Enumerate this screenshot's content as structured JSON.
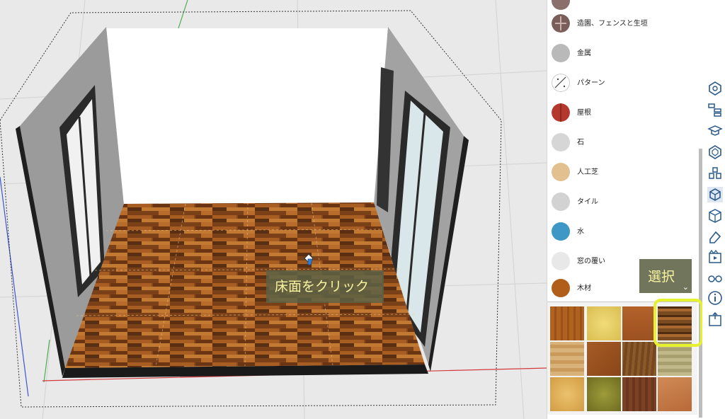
{
  "viewport": {
    "tooltip_text": "床面をクリック",
    "cursor_icon": "paint-bucket-icon"
  },
  "material_panel": {
    "categories": [
      {
        "label": "",
        "icon": "material-swatch",
        "color": "#8a6f6a"
      },
      {
        "label": "造園、フェンスと生垣",
        "icon": "fence-swatch",
        "color": "#7a5e5a"
      },
      {
        "label": "金属",
        "icon": "metal-swatch",
        "color": "#b9b9b9"
      },
      {
        "label": "パターン",
        "icon": "pattern-swatch",
        "color": "#ffffff"
      },
      {
        "label": "屋根",
        "icon": "roof-swatch",
        "color": "#b4382d"
      },
      {
        "label": "石",
        "icon": "stone-swatch",
        "color": "#d6d6d6"
      },
      {
        "label": "人工芝",
        "icon": "turf-swatch",
        "color": "#e2c08f"
      },
      {
        "label": "タイル",
        "icon": "tile-swatch",
        "color": "#d2d2d2"
      },
      {
        "label": "水",
        "icon": "water-swatch",
        "color": "#3f97c5"
      },
      {
        "label": "窓の覆い",
        "icon": "window-covering-swatch",
        "color": "#e8e8e8"
      },
      {
        "label": "木材",
        "icon": "wood-swatch",
        "color": "#b25e1b"
      }
    ],
    "select_label": "選択",
    "select_chevron": "⌄",
    "thumbnails": [
      {
        "name": "wood-thumb-1",
        "color": "#b0621f"
      },
      {
        "name": "wood-thumb-2",
        "color": "#e8d06a"
      },
      {
        "name": "wood-thumb-3",
        "color": "#a85a26"
      },
      {
        "name": "wood-thumb-4",
        "color": "#7a4a20"
      },
      {
        "name": "wood-thumb-5",
        "color": "#d9b27a"
      },
      {
        "name": "wood-thumb-6",
        "color": "#9a5424"
      },
      {
        "name": "wood-thumb-7",
        "color": "#8b5a2b"
      },
      {
        "name": "wood-thumb-8",
        "color": "#c2b98a"
      },
      {
        "name": "wood-thumb-9",
        "color": "#e0b25e"
      },
      {
        "name": "wood-thumb-10",
        "color": "#8a8a2e"
      },
      {
        "name": "wood-thumb-11",
        "color": "#7d4225"
      },
      {
        "name": "wood-thumb-12",
        "color": "#c47a48"
      }
    ]
  },
  "toolbar": {
    "tools": [
      "entity-info-icon",
      "outliner-icon",
      "instructor-icon",
      "components-icon",
      "styles-icon",
      "materials-icon",
      "tags-icon",
      "scenes-icon",
      "shadows-icon",
      "soften-edges-icon",
      "display-icon",
      "info-icon",
      "export-icon"
    ]
  },
  "colors": {
    "accent_yellow": "#e5f22d",
    "tooltip_bg": "#5c6246",
    "tooltip_text": "#f7f3a0",
    "floor": "#8b4a1c"
  }
}
